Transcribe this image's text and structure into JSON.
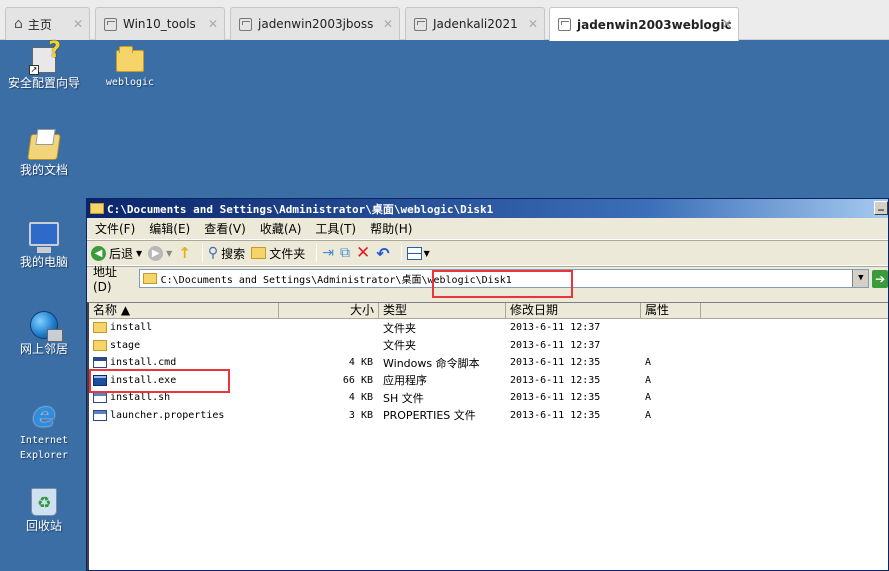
{
  "vm_tabs": [
    {
      "label": "主页",
      "icon": "home-icon"
    },
    {
      "label": "Win10_tools",
      "icon": "vm-icon"
    },
    {
      "label": "jadenwin2003jboss",
      "icon": "vm-icon"
    },
    {
      "label": "Jadenkali2021",
      "icon": "vm-icon"
    },
    {
      "label": "jadenwin2003weblogic",
      "icon": "vm-icon",
      "active": true
    }
  ],
  "desktop": {
    "icons": [
      {
        "label": "安全配置向导",
        "icon": "security-wizard-icon"
      },
      {
        "label": "weblogic",
        "icon": "folder-icon"
      },
      {
        "label": "我的文档",
        "icon": "my-documents-icon"
      },
      {
        "label": "我的电脑",
        "icon": "my-computer-icon"
      },
      {
        "label": "网上邻居",
        "icon": "network-places-icon"
      },
      {
        "label": "Internet Explorer",
        "icon": "internet-explorer-icon"
      },
      {
        "label": "回收站",
        "icon": "recycle-bin-icon"
      }
    ]
  },
  "explorer": {
    "title": "C:\\Documents and Settings\\Administrator\\桌面\\weblogic\\Disk1",
    "menu": [
      "文件(F)",
      "编辑(E)",
      "查看(V)",
      "收藏(A)",
      "工具(T)",
      "帮助(H)"
    ],
    "toolbar": {
      "back": "后退",
      "search": "搜索",
      "folders": "文件夹"
    },
    "address": {
      "label": "地址(D)",
      "path": "C:\\Documents and Settings\\Administrator\\桌面\\weblogic\\Disk1"
    },
    "columns": {
      "name": "名称 ▲",
      "size": "大小",
      "type": "类型",
      "modified": "修改日期",
      "attributes": "属性"
    },
    "files": [
      {
        "name": "install",
        "size": "",
        "type": "文件夹",
        "modified": "2013-6-11 12:37",
        "attributes": "",
        "icon": "folder"
      },
      {
        "name": "stage",
        "size": "",
        "type": "文件夹",
        "modified": "2013-6-11 12:37",
        "attributes": "",
        "icon": "folder"
      },
      {
        "name": "install.cmd",
        "size": "4 KB",
        "type": "Windows 命令脚本",
        "modified": "2013-6-11 12:35",
        "attributes": "A",
        "icon": "cmd"
      },
      {
        "name": "install.exe",
        "size": "66 KB",
        "type": "应用程序",
        "modified": "2013-6-11 12:35",
        "attributes": "A",
        "icon": "exe"
      },
      {
        "name": "install.sh",
        "size": "4 KB",
        "type": "SH 文件",
        "modified": "2013-6-11 12:35",
        "attributes": "A",
        "icon": "sh"
      },
      {
        "name": "launcher.properties",
        "size": "3 KB",
        "type": "PROPERTIES 文件",
        "modified": "2013-6-11 12:35",
        "attributes": "A",
        "icon": "properties"
      }
    ]
  },
  "colors": {
    "desktop": "#3a6ea5",
    "highlight": "#e8363c",
    "title_bar": "#0a246a"
  }
}
